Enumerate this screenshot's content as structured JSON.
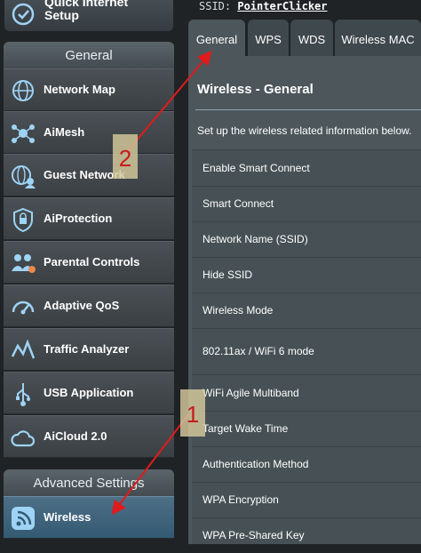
{
  "quick_setup": {
    "label": "Quick Internet Setup"
  },
  "menu": {
    "general_header": "General",
    "general_items": [
      {
        "label": "Network Map",
        "icon": "network-map-icon"
      },
      {
        "label": "AiMesh",
        "icon": "aimesh-icon"
      },
      {
        "label": "Guest Network",
        "icon": "guest-network-icon"
      },
      {
        "label": "AiProtection",
        "icon": "aiprotection-icon"
      },
      {
        "label": "Parental Controls",
        "icon": "parental-controls-icon"
      },
      {
        "label": "Adaptive QoS",
        "icon": "adaptive-qos-icon"
      },
      {
        "label": "Traffic Analyzer",
        "icon": "traffic-analyzer-icon"
      },
      {
        "label": "USB Application",
        "icon": "usb-application-icon"
      },
      {
        "label": "AiCloud 2.0",
        "icon": "aicloud-icon"
      }
    ],
    "advanced_header": "Advanced Settings",
    "advanced_items": [
      {
        "label": "Wireless",
        "icon": "wireless-icon",
        "active": true
      }
    ]
  },
  "ssid_bar": {
    "prefix": "SSID:",
    "value": "PointerClicker"
  },
  "tabs": [
    {
      "label": "General",
      "active": true
    },
    {
      "label": "WPS"
    },
    {
      "label": "WDS"
    },
    {
      "label": "Wireless MAC"
    }
  ],
  "panel": {
    "title": "Wireless - General",
    "description": "Set up the wireless related information below.",
    "rows": [
      "Enable Smart Connect",
      "Smart Connect",
      "Network Name (SSID)",
      "Hide SSID",
      "Wireless Mode",
      "802.11ax / WiFi 6 mode",
      "WiFi Agile Multiband",
      "Target Wake Time",
      "Authentication Method",
      "WPA Encryption",
      "WPA Pre-Shared Key"
    ]
  },
  "annotations": [
    {
      "number": "1"
    },
    {
      "number": "2"
    }
  ],
  "colors": {
    "annotation_red": "#e01b1b",
    "callout_fill": "#d6c99c",
    "active_menu": "#3d6580",
    "panel_bg": "#4d565b"
  }
}
